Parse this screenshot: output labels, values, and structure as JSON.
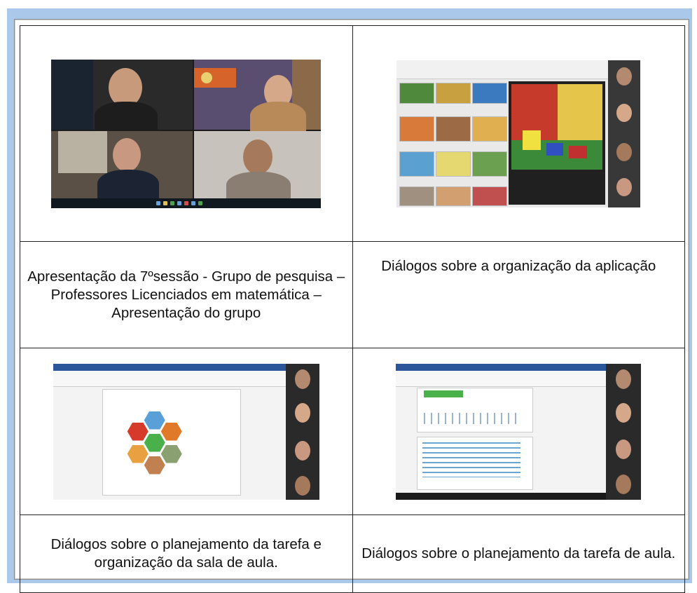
{
  "captions": {
    "c1": "Apresentação da 7ºsessão - Grupo de pesquisa – Professores Licenciados em matemática – Apresentação do grupo",
    "c2": "Diálogos sobre a organização da aplicação",
    "c3": "Diálogos sobre o planejamento da tarefa e organização da sala de aula.",
    "c4": "Diálogos sobre o planejamento da tarefa de aula."
  },
  "colors": {
    "frame": "#a9c8ea",
    "border": "#222222"
  },
  "icons": [
    "video-call-screenshot",
    "image-search-screenshot",
    "document-screenshot"
  ]
}
